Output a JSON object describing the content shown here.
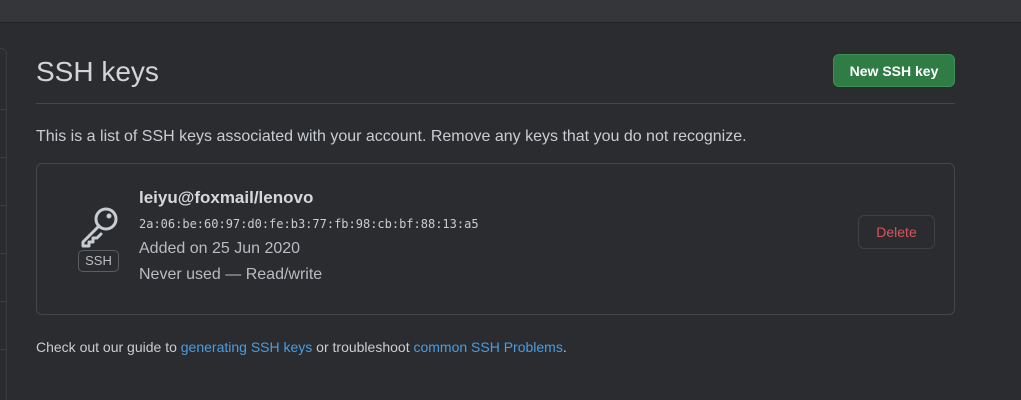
{
  "page": {
    "title": "SSH keys",
    "new_key_button": "New SSH key",
    "description": "This is a list of SSH keys associated with your account. Remove any keys that you do not recognize."
  },
  "key": {
    "icon": "key-icon",
    "type_badge": "SSH",
    "name": "leiyu@foxmail/lenovo",
    "fingerprint": "2a:06:be:60:97:d0:fe:b3:77:fb:98:cb:bf:88:13:a5",
    "added": "Added on 25 Jun 2020",
    "usage": "Never used — Read/write",
    "delete_button": "Delete"
  },
  "guide": {
    "prefix": "Check out our guide to ",
    "link1": "generating SSH keys",
    "middle": " or troubleshoot ",
    "link2": "common SSH Problems",
    "suffix": "."
  },
  "colors": {
    "background": "#2b2c2f",
    "primary_button": "#2f7d45",
    "danger_text": "#d7545f",
    "link": "#4a9de0"
  }
}
